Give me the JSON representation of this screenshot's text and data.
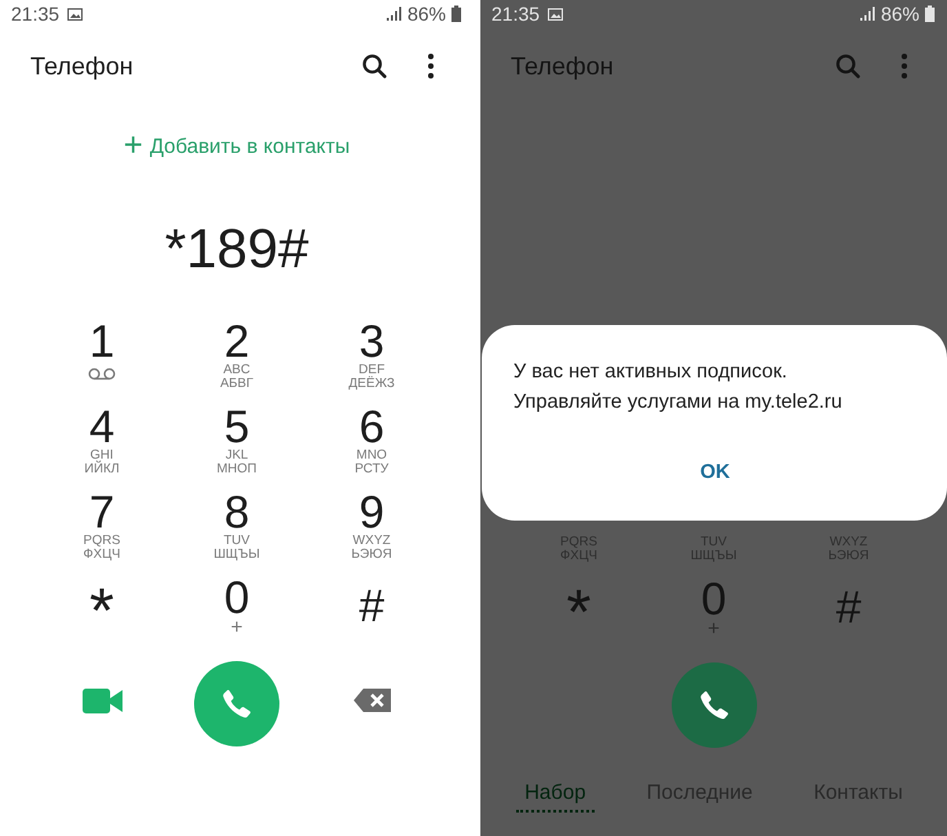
{
  "screens": [
    {
      "dimmed": false,
      "status_bar": {
        "time": "21:35",
        "battery": "86%"
      },
      "app_bar": {
        "title": "Телефон"
      },
      "add_contact": {
        "icon": "+",
        "label": "Добавить в контакты"
      },
      "dialed_number": "*189#",
      "keys": [
        {
          "kind": "voicemail",
          "digit": "1"
        },
        {
          "kind": "letters",
          "digit": "2",
          "latin": "ABC",
          "cyrillic": "АБВГ"
        },
        {
          "kind": "letters",
          "digit": "3",
          "latin": "DEF",
          "cyrillic": "ДЕЁЖЗ"
        },
        {
          "kind": "letters",
          "digit": "4",
          "latin": "GHI",
          "cyrillic": "ИЙКЛ"
        },
        {
          "kind": "letters",
          "digit": "5",
          "latin": "JKL",
          "cyrillic": "МНОП"
        },
        {
          "kind": "letters",
          "digit": "6",
          "latin": "MNO",
          "cyrillic": "РСТУ"
        },
        {
          "kind": "letters",
          "digit": "7",
          "latin": "PQRS",
          "cyrillic": "ФХЦЧ"
        },
        {
          "kind": "letters",
          "digit": "8",
          "latin": "TUV",
          "cyrillic": "ШЩЪЫ"
        },
        {
          "kind": "letters",
          "digit": "9",
          "latin": "WXYZ",
          "cyrillic": "ЬЭЮЯ"
        },
        {
          "kind": "asterisk",
          "digit": "*"
        },
        {
          "kind": "plus",
          "digit": "0",
          "sub": "+"
        },
        {
          "kind": "symbol",
          "digit": "#"
        }
      ],
      "buttons": [
        {
          "kind": "video"
        },
        {
          "kind": "call"
        },
        {
          "kind": "backspace"
        }
      ]
    },
    {
      "dimmed": true,
      "status_bar": {
        "time": "21:35",
        "battery": "86%"
      },
      "app_bar": {
        "title": "Телефон"
      },
      "dialog": {
        "lines": [
          "У вас нет активных подписок.",
          "Управляйте услугами на my.tele2.ru"
        ],
        "button": "OK"
      },
      "keys": [
        {
          "kind": "letters",
          "latin": "PQRS",
          "cyrillic": "ФХЦЧ"
        },
        {
          "kind": "letters",
          "latin": "TUV",
          "cyrillic": "ШЩЪЫ"
        },
        {
          "kind": "letters",
          "latin": "WXYZ",
          "cyrillic": "ЬЭЮЯ"
        },
        {
          "kind": "asterisk",
          "digit": "*"
        },
        {
          "kind": "plus",
          "digit": "0",
          "sub": "+"
        },
        {
          "kind": "symbol",
          "digit": "#"
        }
      ],
      "buttons": [
        {
          "kind": "call"
        }
      ],
      "tabs": [
        {
          "label": "Набор",
          "selected": true
        },
        {
          "label": "Последние",
          "selected": false
        },
        {
          "label": "Контакты",
          "selected": false
        }
      ]
    }
  ]
}
